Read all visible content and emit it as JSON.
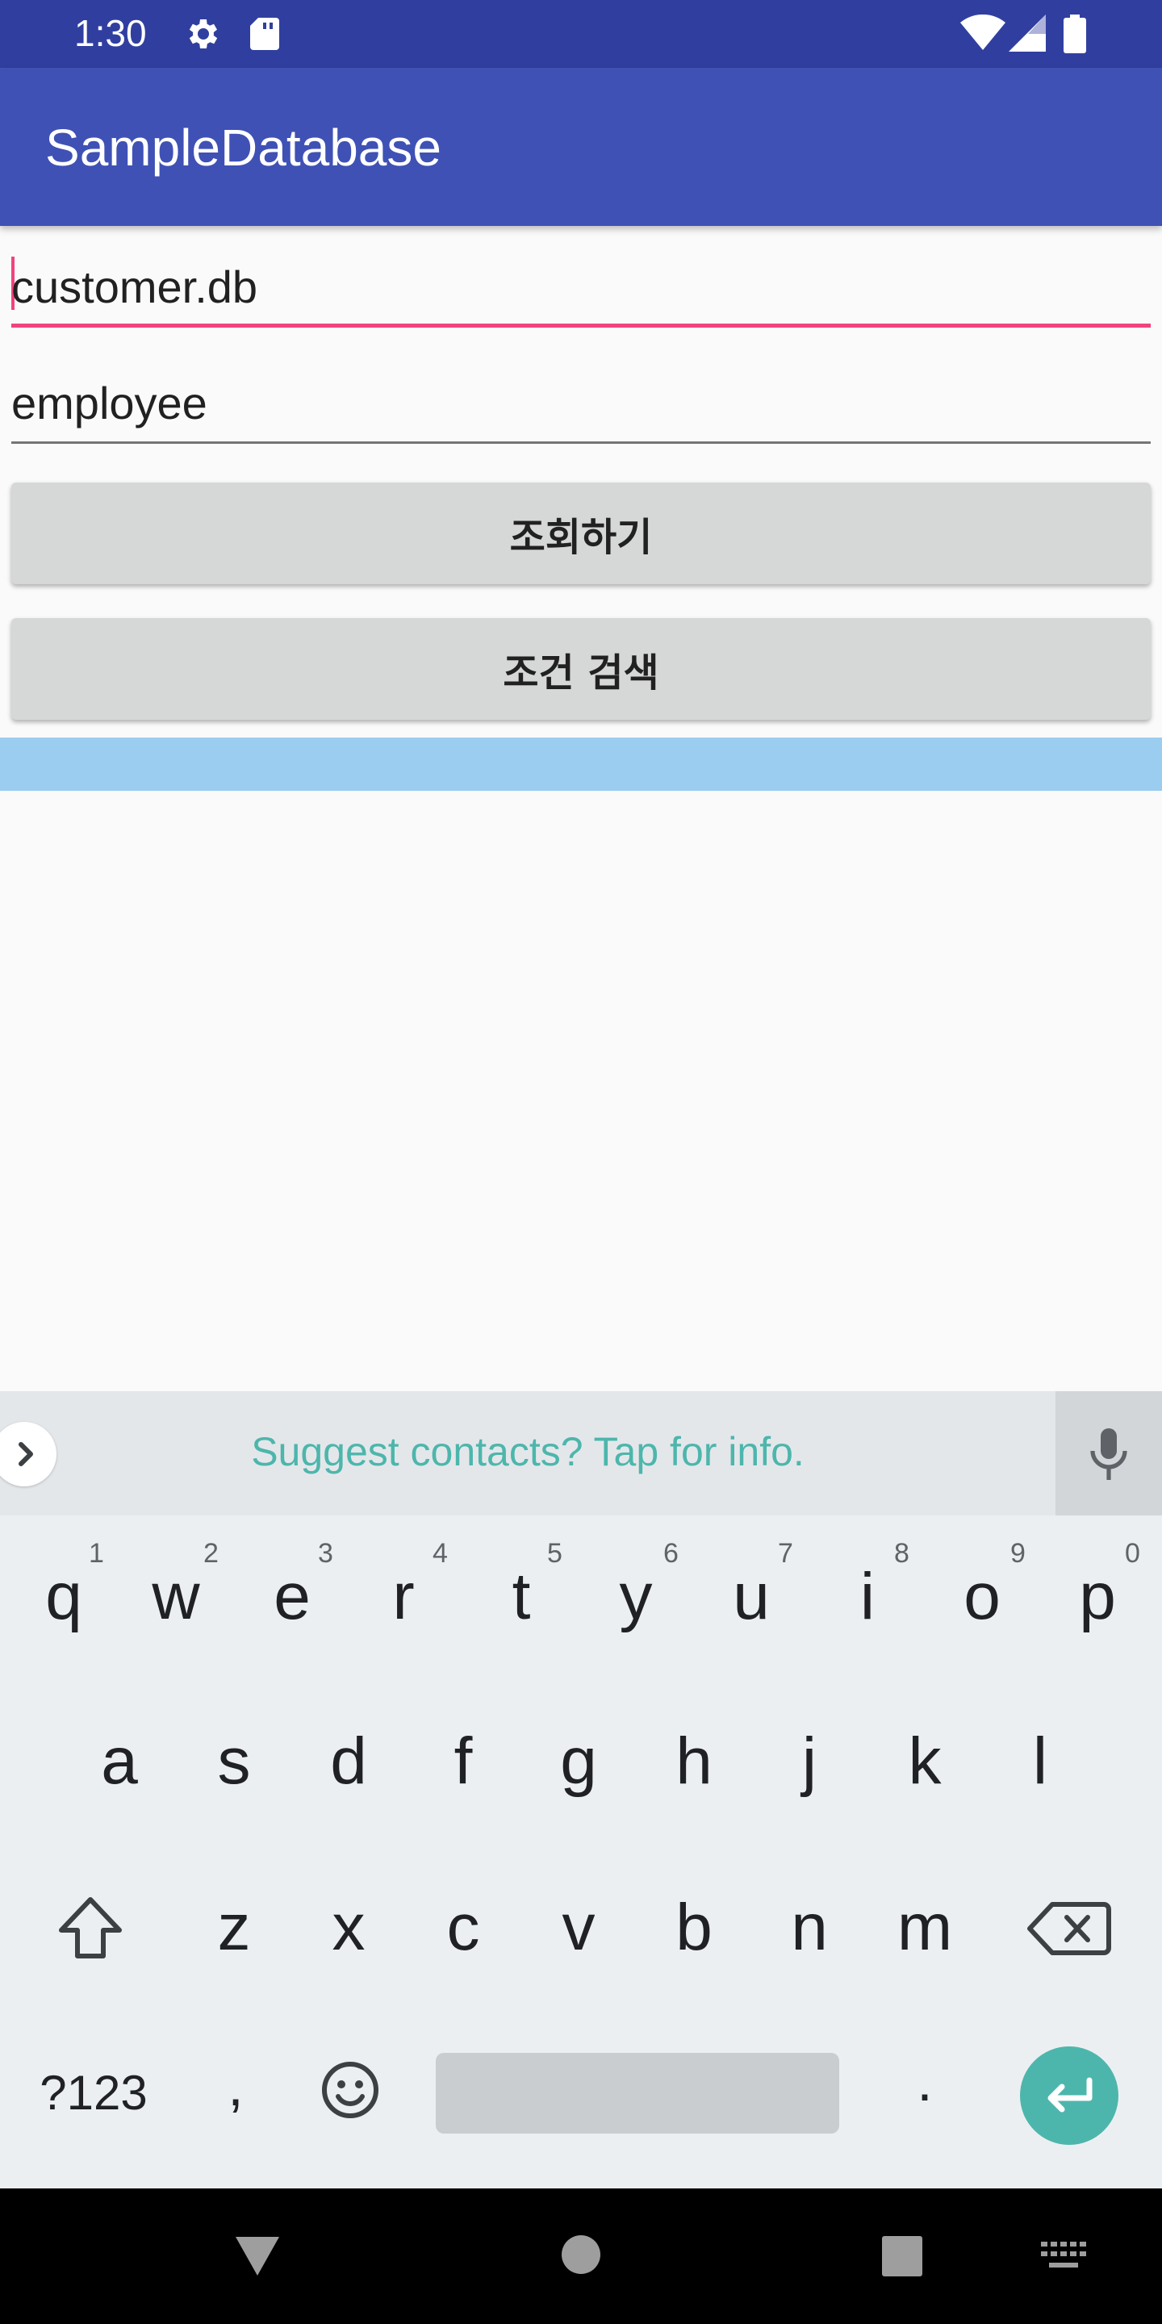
{
  "status_bar": {
    "time": "1:30",
    "icons": [
      "gear-icon",
      "sd-card-icon",
      "wifi-icon",
      "cell-signal-icon",
      "battery-icon"
    ]
  },
  "app_bar": {
    "title": "SampleDatabase"
  },
  "form": {
    "database_name": "customer.db",
    "table_name": "employee",
    "query_button": "조회하기",
    "search_button": "조건 검색"
  },
  "keyboard": {
    "suggestion": "Suggest contacts? Tap for info.",
    "row1": [
      {
        "key": "q",
        "hint": "1"
      },
      {
        "key": "w",
        "hint": "2"
      },
      {
        "key": "e",
        "hint": "3"
      },
      {
        "key": "r",
        "hint": "4"
      },
      {
        "key": "t",
        "hint": "5"
      },
      {
        "key": "y",
        "hint": "6"
      },
      {
        "key": "u",
        "hint": "7"
      },
      {
        "key": "i",
        "hint": "8"
      },
      {
        "key": "o",
        "hint": "9"
      },
      {
        "key": "p",
        "hint": "0"
      }
    ],
    "row2": [
      "a",
      "s",
      "d",
      "f",
      "g",
      "h",
      "j",
      "k",
      "l"
    ],
    "row3": [
      "z",
      "x",
      "c",
      "v",
      "b",
      "n",
      "m"
    ],
    "symbols_key": "?123",
    "comma_key": ",",
    "period_key": "."
  },
  "colors": {
    "primary_dark": "#303f9f",
    "primary": "#3f51b5",
    "accent": "#f1437e",
    "keyboard_accent": "#4db6ac",
    "list_highlight": "#9acdef"
  }
}
